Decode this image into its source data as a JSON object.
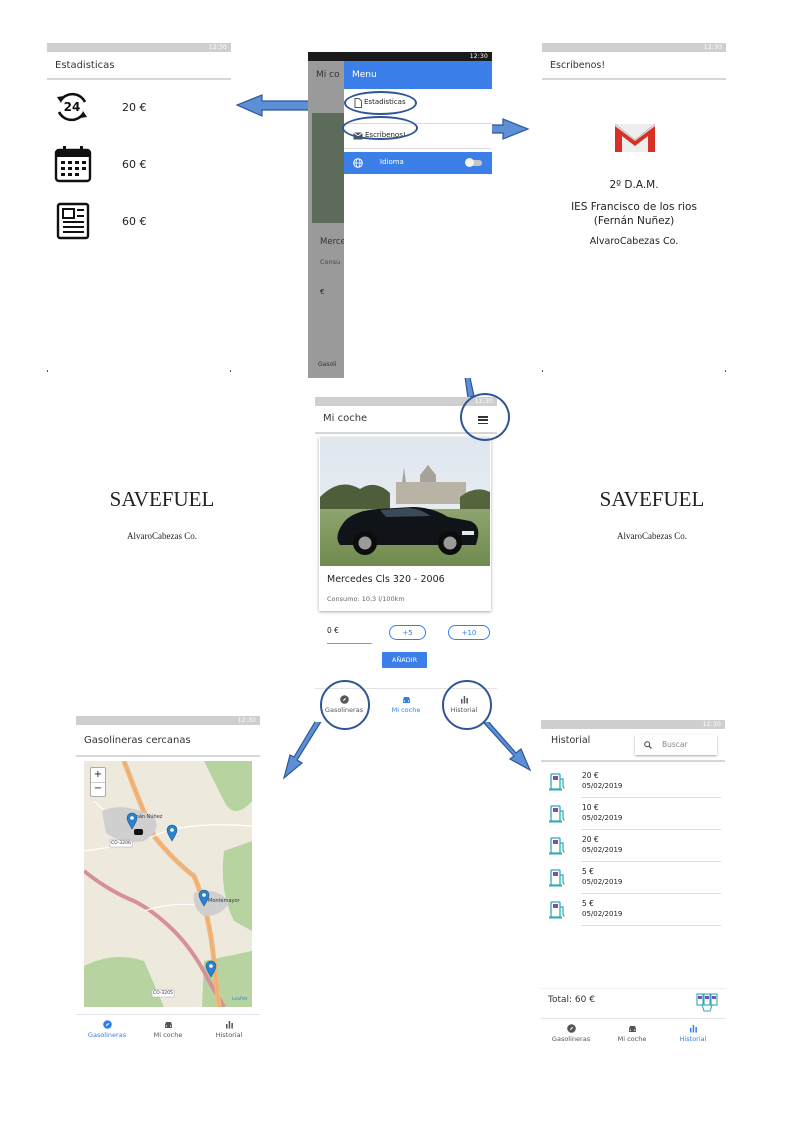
{
  "colors": {
    "accent": "#2f80ed",
    "gmail_red": "#d93025",
    "arrow": "#5b8fd6",
    "arrow_stroke": "#2f5597"
  },
  "status_time": "12:30",
  "stats_screen": {
    "title": "Estadisticas",
    "rows": [
      {
        "icon": "24h-icon",
        "value": "20 €"
      },
      {
        "icon": "calendar-icon",
        "value": "60 €"
      },
      {
        "icon": "newspaper-icon",
        "value": "60 €"
      }
    ]
  },
  "menu_screen": {
    "behind_title": "Mi co",
    "behind_model": "Merce",
    "behind_consumo": "Consu",
    "behind_euro": "€",
    "behind_nav": "Gasoli",
    "menu_title": "Menu",
    "items": [
      {
        "icon": "document-icon",
        "label": "Estadisticas"
      },
      {
        "icon": "mail-icon",
        "label": "Escribenos!"
      }
    ],
    "language_label": "Idioma"
  },
  "contact_screen": {
    "title": "Escribenos!",
    "line1": "2º D.A.M.",
    "line2": "IES Francisco de los rios",
    "line3": "(Fernán Nuñez)",
    "line4": "AlvaroCabezas Co."
  },
  "splash_left": {
    "title": "SAVEFUEL",
    "subtitle": "AlvaroCabezas Co."
  },
  "splash_right": {
    "title": "SAVEFUEL",
    "subtitle": "AlvaroCabezas Co."
  },
  "car_screen": {
    "title": "Mi coche",
    "car_model": "Mercedes Cls 320 - 2006",
    "consumption": "Consumo: 10,3 l/100km",
    "amount": "0 €",
    "btn_plus5": "+5",
    "btn_plus10": "+10",
    "btn_add": "AÑADIR",
    "nav": [
      {
        "icon": "compass-icon",
        "label": "Gasolineras"
      },
      {
        "icon": "car-icon",
        "label": "Mi coche"
      },
      {
        "icon": "bar-chart-icon",
        "label": "Historial"
      }
    ]
  },
  "map_screen": {
    "title": "Gasolineras cercanas",
    "zoom_in": "+",
    "zoom_out": "−",
    "places": [
      "Fernán Núñez",
      "Montemayor"
    ],
    "roads": [
      "CO-3206",
      "CO-3205"
    ],
    "attribution": "Leaflet",
    "nav": [
      {
        "icon": "compass-icon",
        "label": "Gasolineras"
      },
      {
        "icon": "car-icon",
        "label": "Mi coche"
      },
      {
        "icon": "bar-chart-icon",
        "label": "Historial"
      }
    ]
  },
  "history_screen": {
    "title": "Historial",
    "search_placeholder": "Buscar",
    "entries": [
      {
        "amount": "20 €",
        "date": "05/02/2019"
      },
      {
        "amount": "10 €",
        "date": "05/02/2019"
      },
      {
        "amount": "20 €",
        "date": "05/02/2019"
      },
      {
        "amount": "5 €",
        "date": "05/02/2019"
      },
      {
        "amount": "5 €",
        "date": "05/02/2019"
      }
    ],
    "total": "Total: 60 €",
    "nav": [
      {
        "icon": "compass-icon",
        "label": "Gasolineras"
      },
      {
        "icon": "car-icon",
        "label": "Mi coche"
      },
      {
        "icon": "bar-chart-icon",
        "label": "Historial"
      }
    ]
  }
}
